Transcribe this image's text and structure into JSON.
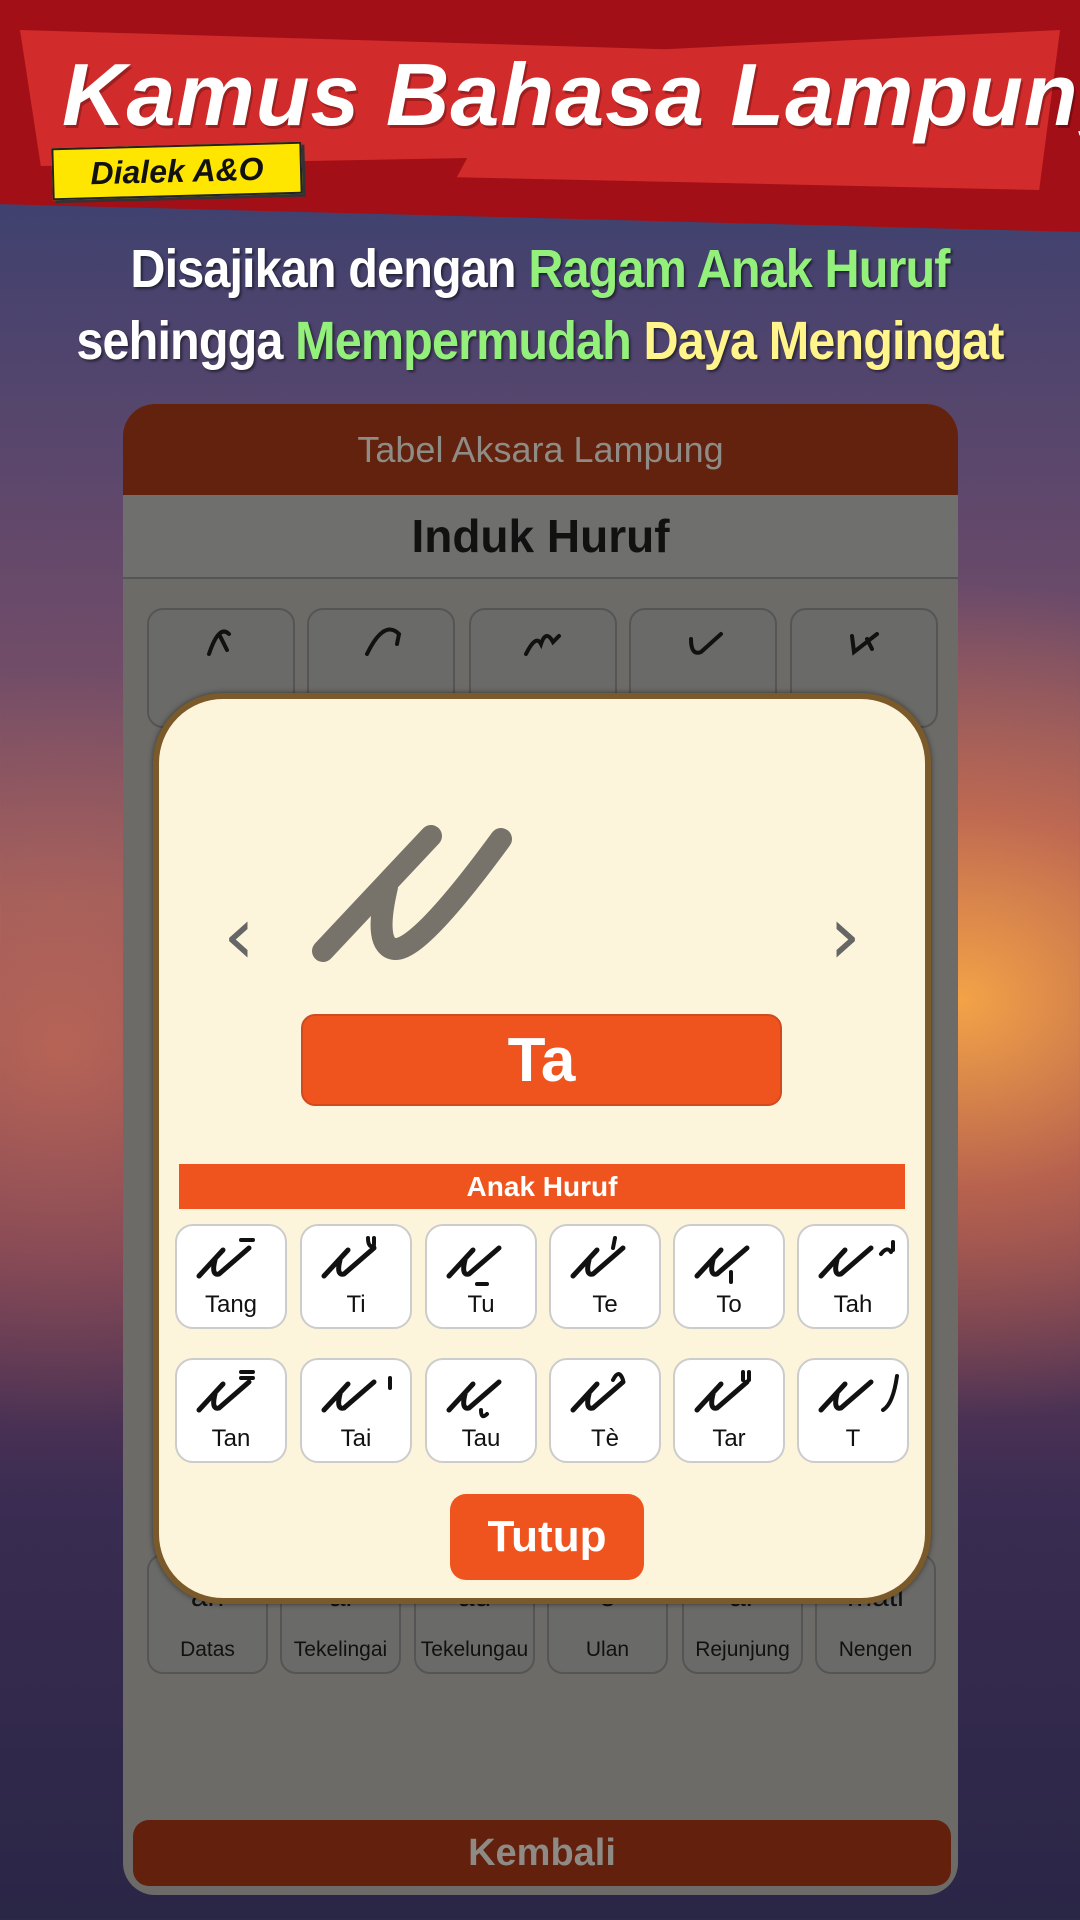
{
  "banner": {
    "title": "Kamus Bahasa Lampung",
    "badge": "Dialek A&O",
    "colors": {
      "dark_red": "#a20f16",
      "ribbon_red": "#d22b2b",
      "badge_yellow": "#ffe600"
    }
  },
  "tagline": {
    "line1": {
      "white": "Disajikan dengan ",
      "green": "Ragam Anak Huruf"
    },
    "line2": {
      "white": "sehingga ",
      "green": "Mempermudah ",
      "yellow": "Daya Mengingat"
    }
  },
  "app": {
    "header_title": "Tabel Aksara Lampung",
    "section_title": "Induk Huruf",
    "bottom_row": [
      {
        "latin": "an",
        "name": "Datas"
      },
      {
        "latin": "ai",
        "name": "Tekelingai"
      },
      {
        "latin": "au",
        "name": "Tekelungau"
      },
      {
        "latin": "e",
        "name": "Ulan"
      },
      {
        "latin": "ar",
        "name": "Rejunjung"
      },
      {
        "latin": "mati",
        "name": "Nengen"
      }
    ],
    "back_button": "Kembali",
    "accent": "#f0541e"
  },
  "modal": {
    "letter": "Ta",
    "prev_icon": "chevron-left-icon",
    "next_icon": "chevron-right-icon",
    "anak_header": "Anak Huruf",
    "anak": [
      {
        "label": "Tang",
        "mark": "bar-above"
      },
      {
        "label": "Ti",
        "mark": "hook-above"
      },
      {
        "label": "Tu",
        "mark": "bar-below"
      },
      {
        "label": "Te",
        "mark": "tick-above"
      },
      {
        "label": "To",
        "mark": "tick-below"
      },
      {
        "label": "Tah",
        "mark": "curl-right"
      },
      {
        "label": "Tan",
        "mark": "double-bar-above"
      },
      {
        "label": "Tai",
        "mark": "tick-right"
      },
      {
        "label": "Tau",
        "mark": "cup-below"
      },
      {
        "label": "Tè",
        "mark": "cap-above"
      },
      {
        "label": "Tar",
        "mark": "quote-above"
      },
      {
        "label": "T",
        "mark": "slash-right"
      }
    ],
    "close_button": "Tutup"
  }
}
